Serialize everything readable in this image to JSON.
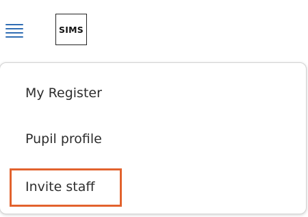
{
  "header": {
    "menu_icon": "hamburger-menu-icon",
    "logo_text": "SIMS",
    "menu_icon_color": "#2f6db4"
  },
  "menu": {
    "items": [
      {
        "label": "My Register"
      },
      {
        "label": "Pupil profile"
      },
      {
        "label": "Invite staff",
        "highlighted": true
      }
    ],
    "highlight_color": "#e2622d"
  }
}
